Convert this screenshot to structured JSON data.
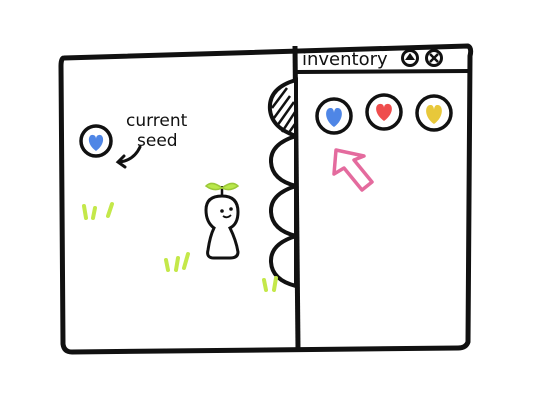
{
  "panel": {
    "title": "inventory"
  },
  "game_area": {
    "current_seed_label_line1": "current",
    "current_seed_label_line2": "seed",
    "current_seed_color": "#4f86e6"
  },
  "inventory": {
    "items": [
      {
        "color": "#4f86e6"
      },
      {
        "color": "#ef4d4d"
      },
      {
        "color": "#e8c83a"
      }
    ]
  },
  "colors": {
    "ink": "#111111",
    "grass": "#c4e84a",
    "arrow": "#e46b9e",
    "sprout_leaf": "#b9e84a"
  }
}
